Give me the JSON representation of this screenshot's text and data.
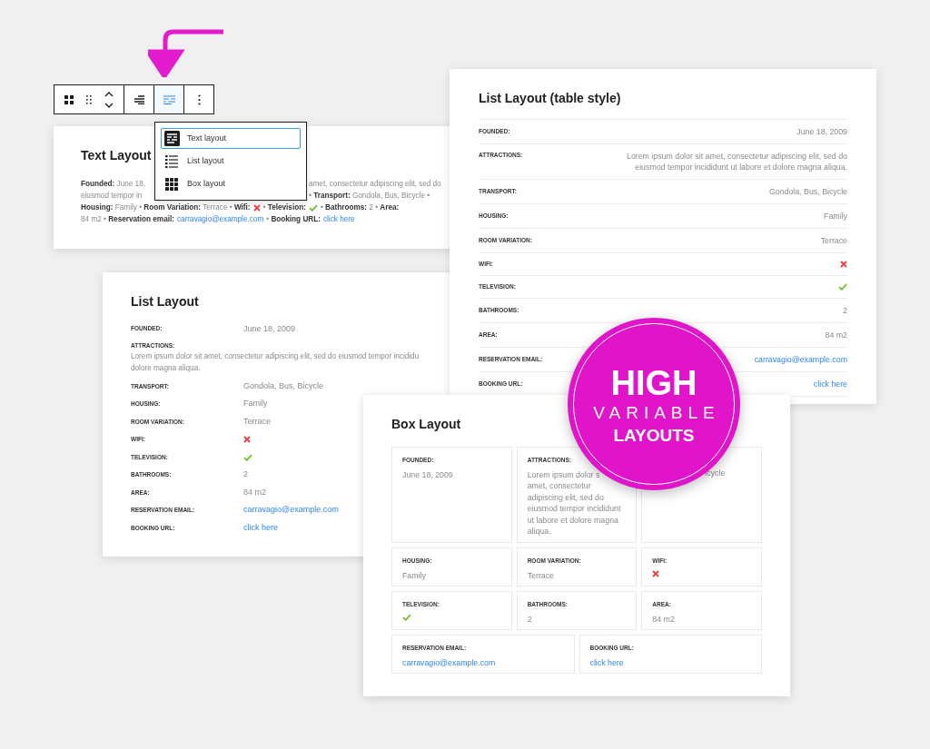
{
  "toolbar": {
    "buttons": [
      {
        "kind": "block",
        "selected": false
      },
      {
        "kind": "drag",
        "selected": false
      },
      {
        "kind": "move",
        "selected": false
      },
      {
        "kind": "align",
        "selected": false
      },
      {
        "kind": "layout",
        "selected": true
      },
      {
        "kind": "more",
        "selected": false
      }
    ]
  },
  "layout_menu": {
    "items": [
      {
        "label": "Text layout",
        "kind": "text",
        "selected": true
      },
      {
        "label": "List layout",
        "kind": "list",
        "selected": false
      },
      {
        "label": "Box layout",
        "kind": "box",
        "selected": false
      }
    ]
  },
  "text_card": {
    "title": "Text Layout",
    "lines": [
      {
        "left": [
          {
            "kind": "text",
            "text": "**Founded:** June 18,"
          }
        ],
        "right": [
          {
            "kind": "text",
            "text": "amet, consectetur adipiscing elit, sed do"
          }
        ]
      },
      {
        "left": [
          {
            "kind": "text",
            "text": "eiusmod tempor in"
          }
        ],
        "right": [
          {
            "kind": "text",
            "text": "• **Transport:** Gondola, Bus, Bicycle •"
          }
        ]
      },
      {
        "left": [
          {
            "kind": "text",
            "text": "**Housing:** Family • **Room Variation:** Terrace • **Wifi:**"
          },
          {
            "kind": "bool",
            "on": false
          },
          {
            "kind": "text",
            "text": "• **Television:**"
          },
          {
            "kind": "bool",
            "on": true
          },
          {
            "kind": "text",
            "text": "• **Bathrooms:** 2 • **Area:**"
          }
        ]
      },
      {
        "left": [
          {
            "kind": "text",
            "text": "84 m2 • **Reservation email:**"
          },
          {
            "kind": "link",
            "text": "carravagio@example.com"
          },
          {
            "kind": "text",
            "text": "• **Booking URL:**"
          },
          {
            "kind": "link",
            "text": "click here"
          }
        ]
      }
    ]
  },
  "table_card": {
    "title": "List Layout (table style)",
    "rows": [
      {
        "label": "FOUNDED:",
        "kind": "text",
        "value": "June 18, 2009"
      },
      {
        "label": "ATTRACTIONS:",
        "kind": "text",
        "value": "Lorem ipsum dolor sit amet, consectetur adipiscing elit, sed do eiusmod tempor incididunt ut labore et dolore magna aliqua."
      },
      {
        "label": "TRANSPORT:",
        "kind": "text",
        "value": "Gondola, Bus, Bicycle"
      },
      {
        "label": "HOUSING:",
        "kind": "text",
        "value": "Family"
      },
      {
        "label": "ROOM VARIATION:",
        "kind": "text",
        "value": "Terrace"
      },
      {
        "label": "WIFI:",
        "kind": "bool",
        "on": false
      },
      {
        "label": "TELEVISION:",
        "kind": "bool",
        "on": true
      },
      {
        "label": "BATHROOMS:",
        "kind": "text",
        "value": "2"
      },
      {
        "label": "AREA:",
        "kind": "text",
        "value": "84 m2"
      },
      {
        "label": "RESERVATION EMAIL:",
        "kind": "link",
        "value": "carravagio@example.com"
      },
      {
        "label": "BOOKING URL:",
        "kind": "link",
        "value": "click here"
      }
    ]
  },
  "list_card": {
    "title": "List Layout",
    "rows": [
      {
        "label": "FOUNDED:",
        "kind": "text",
        "value": "June 18, 2009"
      },
      {
        "label": "ATTRACTIONS:",
        "kind": "lines",
        "lines": [
          "Lorem ipsum dolor sit amet, consectetur adipiscing elit, sed do eiusmod tempor incididu",
          "dolore magna aliqua."
        ]
      },
      {
        "label": "TRANSPORT:",
        "kind": "text",
        "value": "Gondola, Bus, Bicycle"
      },
      {
        "label": "HOUSING:",
        "kind": "text",
        "value": "Family"
      },
      {
        "label": "ROOM VARIATION:",
        "kind": "text",
        "value": "Terrace"
      },
      {
        "label": "WIFI:",
        "kind": "bool",
        "on": false
      },
      {
        "label": "TELEVISION:",
        "kind": "bool",
        "on": true
      },
      {
        "label": "BATHROOMS:",
        "kind": "text",
        "value": "2"
      },
      {
        "label": "AREA:",
        "kind": "text",
        "value": "84 m2"
      },
      {
        "label": "RESERVATION EMAIL:",
        "kind": "link",
        "value": "carravagio@example.com"
      },
      {
        "label": "BOOKING URL:",
        "kind": "link",
        "value": "click here"
      }
    ]
  },
  "box_card": {
    "title": "Box Layout",
    "rows": [
      [
        {
          "label": "FOUNDED:",
          "kind": "text",
          "value": "June 18, 2009"
        },
        {
          "label": "ATTRACTIONS:",
          "kind": "lines",
          "lines": [
            "Lorem ipsum dolor s",
            "amet, consectetur",
            "adipiscing elit, sed do",
            "eiusmod tempor incididunt",
            "ut labore et dolore magna",
            "aliqua."
          ]
        },
        {
          "kind": "cut",
          "value": "icycle"
        }
      ],
      [
        {
          "label": "HOUSING:",
          "kind": "text",
          "value": "Family"
        },
        {
          "label": "ROOM VARIATION:",
          "kind": "text",
          "value": "Terrace"
        },
        {
          "label": "WIFI:",
          "kind": "bool",
          "on": false
        }
      ],
      [
        {
          "label": "TELEVISION:",
          "kind": "bool",
          "on": true
        },
        {
          "label": "BATHROOMS:",
          "kind": "text",
          "value": "2"
        },
        {
          "label": "AREA:",
          "kind": "text",
          "value": "84 m2"
        }
      ],
      [
        {
          "label": "RESERVATION EMAIL:",
          "kind": "link",
          "value": "carravagio@example.com"
        },
        {
          "label": "BOOKING URL:",
          "kind": "link",
          "value": "click here"
        }
      ]
    ]
  },
  "badge": {
    "lines": [
      "HIGH",
      "VARIABLE",
      "LAYOUTS"
    ]
  }
}
